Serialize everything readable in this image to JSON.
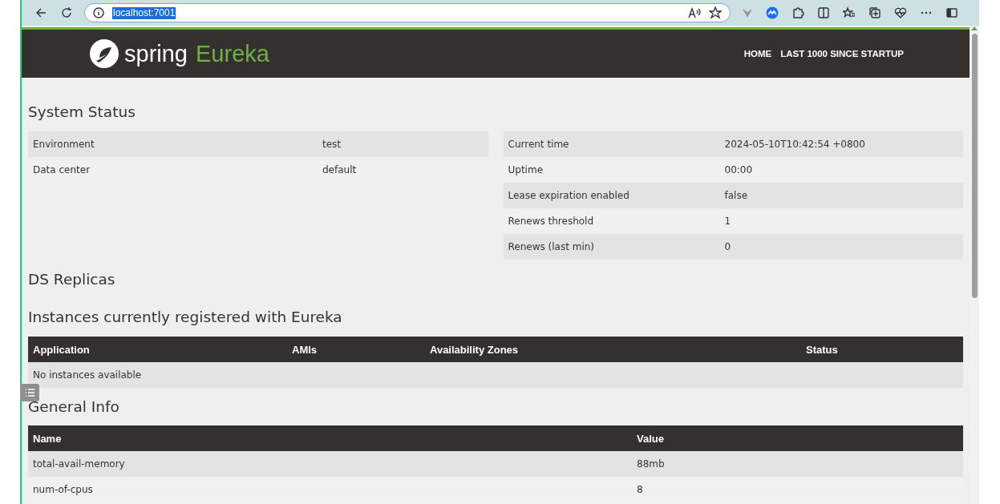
{
  "browser": {
    "url": "localhost:7001"
  },
  "nav": {
    "brand": "spring",
    "product": "Eureka",
    "links": [
      "HOME",
      "LAST 1000 SINCE STARTUP"
    ]
  },
  "system_status": {
    "title": "System Status",
    "left": [
      {
        "label": "Environment",
        "value": "test"
      },
      {
        "label": "Data center",
        "value": "default"
      }
    ],
    "right": [
      {
        "label": "Current time",
        "value": "2024-05-10T10:42:54 +0800"
      },
      {
        "label": "Uptime",
        "value": "00:00"
      },
      {
        "label": "Lease expiration enabled",
        "value": "false"
      },
      {
        "label": "Renews threshold",
        "value": "1"
      },
      {
        "label": "Renews (last min)",
        "value": "0"
      }
    ]
  },
  "ds_replicas": {
    "title": "DS Replicas"
  },
  "instances": {
    "title": "Instances currently registered with Eureka",
    "columns": [
      "Application",
      "AMIs",
      "Availability Zones",
      "Status"
    ],
    "empty_message": "No instances available"
  },
  "general_info": {
    "title": "General Info",
    "columns": [
      "Name",
      "Value"
    ],
    "rows": [
      [
        "total-avail-memory",
        "88mb"
      ],
      [
        "num-of-cpus",
        "8"
      ]
    ]
  }
}
